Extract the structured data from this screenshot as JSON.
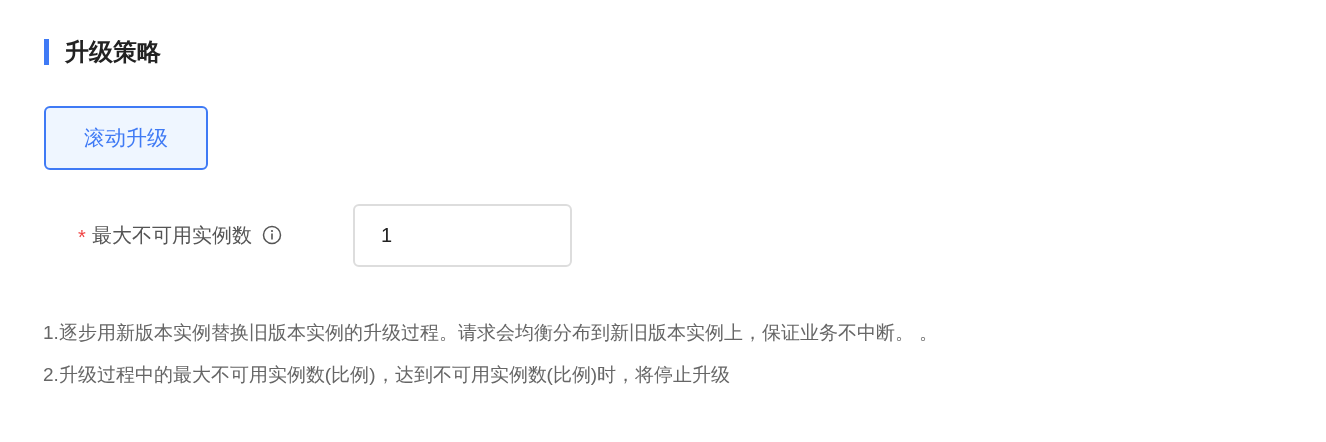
{
  "section": {
    "title": "升级策略"
  },
  "strategies": [
    {
      "label": "滚动升级",
      "selected": true
    }
  ],
  "field": {
    "label": "最大不可用实例数",
    "required_mark": "*",
    "value": "1"
  },
  "notes": [
    "1.逐步用新版本实例替换旧版本实例的升级过程。请求会均衡分布到新旧版本实例上，保证业务不中断。 。",
    "2.升级过程中的最大不可用实例数(比例)，达到不可用实例数(比例)时，将停止升级"
  ]
}
